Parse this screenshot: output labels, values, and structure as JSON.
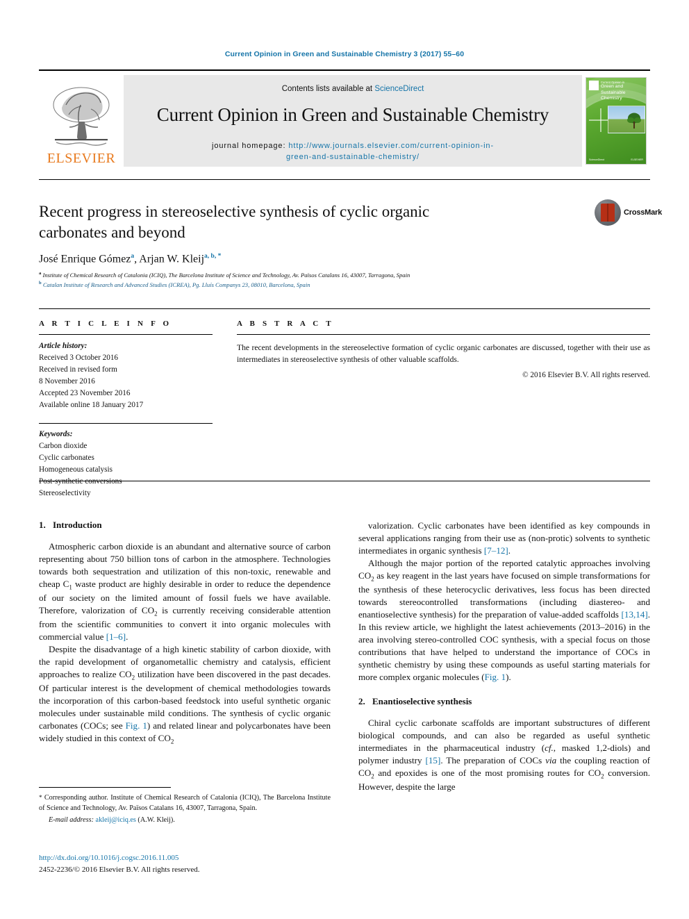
{
  "running_head": "Current Opinion in Green and Sustainable Chemistry 3 (2017) 55–60",
  "masthead": {
    "publisher": "ELSEVIER",
    "contents_prefix": "Contents lists available at ",
    "contents_link": "ScienceDirect",
    "journal_title": "Current Opinion in Green and Sustainable Chemistry",
    "homepage_label": "journal homepage:",
    "homepage_url_line1": "http://www.journals.elsevier.com/current-opinion-in-",
    "homepage_url_line2": "green-and-sustainable-chemistry/",
    "cover": {
      "small_line": "Current Opinion in",
      "line1": "Green and",
      "line2": "Sustainable Chemistry",
      "footer_left": "ScienceDirect",
      "footer_right": "ELSEVIER"
    }
  },
  "article": {
    "title": "Recent progress in stereoselective synthesis of cyclic organic carbonates and beyond",
    "authors_1": "José Enrique Gómez",
    "authors_1_sup": "a",
    "authors_sep": ", ",
    "authors_2": "Arjan W. Kleij",
    "authors_2_sup": "a, b, *",
    "affiliation_a_mark": "a",
    "affiliation_a": "Institute of Chemical Research of Catalonia (ICIQ), The Barcelona Institute of Science and Technology, Av. Països Catalans 16, 43007, Tarragona, Spain",
    "affiliation_b_mark": "b",
    "affiliation_b": "Catalan Institute of Research and Advanced Studies (ICREA), Pg. Lluís Companys 23, 08010, Barcelona, Spain",
    "crossmark_label": "CrossMark"
  },
  "info": {
    "heading": "A R T I C L E   I N F O",
    "history_label": "Article history:",
    "history": [
      "Received 3 October 2016",
      "Received in revised form",
      "8 November 2016",
      "Accepted 23 November 2016",
      "Available online 18 January 2017"
    ],
    "keywords_label": "Keywords:",
    "keywords": [
      "Carbon dioxide",
      "Cyclic carbonates",
      "Homogeneous catalysis",
      "Post-synthetic conversions",
      "Stereoselectivity"
    ]
  },
  "abstract": {
    "heading": "A B S T R A C T",
    "text": "The recent developments in the stereoselective formation of cyclic organic carbonates are discussed, together with their use as intermediates in stereoselective synthesis of other valuable scaffolds.",
    "copyright": "© 2016 Elsevier B.V. All rights reserved."
  },
  "sections": {
    "intro_number": "1.",
    "intro_title": "Introduction",
    "enantio_number": "2.",
    "enantio_title": "Enantioselective synthesis"
  },
  "body": {
    "left_p1_a": "Atmospheric carbon dioxide is an abundant and alternative source of carbon representing about 750 billion tons of carbon in the atmosphere. Technologies towards both sequestration and utilization of this non-toxic, renewable and cheap C",
    "left_p1_c1": "1",
    "left_p1_b": " waste product are highly desirable in order to reduce the dependence of our society on the limited amount of fossil fuels we have available. Therefore, valorization of CO",
    "left_p1_co2": "2",
    "left_p1_c": " is currently receiving considerable attention from the scientific communities to convert it into organic molecules with commercial value ",
    "left_p1_ref": "[1–6]",
    "left_p1_end": ".",
    "left_p2_a": "Despite the disadvantage of a high kinetic stability of carbon dioxide, with the rapid development of organometallic chemistry and catalysis, efficient approaches to realize CO",
    "left_p2_sub1": "2",
    "left_p2_b": " utilization have been discovered in the past decades. Of particular interest is the development of chemical methodologies towards the incorporation of this carbon-based feedstock into useful synthetic organic molecules under sustainable mild conditions. The synthesis of cyclic organic carbonates (COCs; see ",
    "left_p2_fig": "Fig. 1",
    "left_p2_c": ") and related linear and polycarbonates have been widely studied in this context of CO",
    "left_p2_sub2": "2",
    "right_p1_a": "valorization. Cyclic carbonates have been identified as key compounds in several applications ranging from their use as (non-protic) solvents to synthetic intermediates in organic synthesis ",
    "right_p1_ref": "[7–12]",
    "right_p1_end": ".",
    "right_p2_a": "Although the major portion of the reported catalytic approaches involving CO",
    "right_p2_sub1": "2",
    "right_p2_b": " as key reagent in the last years have focused on simple transformations for the synthesis of these heterocyclic derivatives, less focus has been directed towards stereocontrolled transformations (including diastereo- and enantioselective synthesis) for the preparation of value-added scaffolds ",
    "right_p2_ref": "[13,14]",
    "right_p2_c": ". In this review article, we highlight the latest achievements (2013–2016) in the area involving stereo-controlled COC synthesis, with a special focus on those contributions that have helped to understand the importance of COCs in synthetic chemistry by using these compounds as useful starting materials for more complex organic molecules (",
    "right_p2_fig": "Fig. 1",
    "right_p2_end": ").",
    "right_p3_a": "Chiral cyclic carbonate scaffolds are important substructures of different biological compounds, and can also be regarded as useful synthetic intermediates in the pharmaceutical industry (",
    "right_p3_cf": "cf.",
    "right_p3_b": ", masked 1,2-diols) and polymer industry ",
    "right_p3_ref": "[15]",
    "right_p3_c": ". The preparation of COCs ",
    "right_p3_via": "via",
    "right_p3_d": " the coupling reaction of CO",
    "right_p3_sub1": "2",
    "right_p3_e": " and epoxides is one of the most promising routes for CO",
    "right_p3_sub2": "2",
    "right_p3_f": " conversion. However, despite the large"
  },
  "footnotes": {
    "star": "*",
    "corresponding": " Corresponding author. Institute of Chemical Research of Catalonia (ICIQ), The Barcelona Institute of Science and Technology, Av. Països Catalans 16, 43007, Tarragona, Spain.",
    "email_label": "E-mail address:",
    "email": "akleij@iciq.es",
    "email_suffix": " (A.W. Kleij).",
    "doi": "http://dx.doi.org/10.1016/j.cogsc.2016.11.005",
    "issn_line": "2452-2236/© 2016 Elsevier B.V. All rights reserved."
  },
  "colors": {
    "link": "#1574a8",
    "elsevier_orange": "#e87a1e",
    "crossmark_red": "#b62f16",
    "band_grey": "#e8e8e8"
  }
}
